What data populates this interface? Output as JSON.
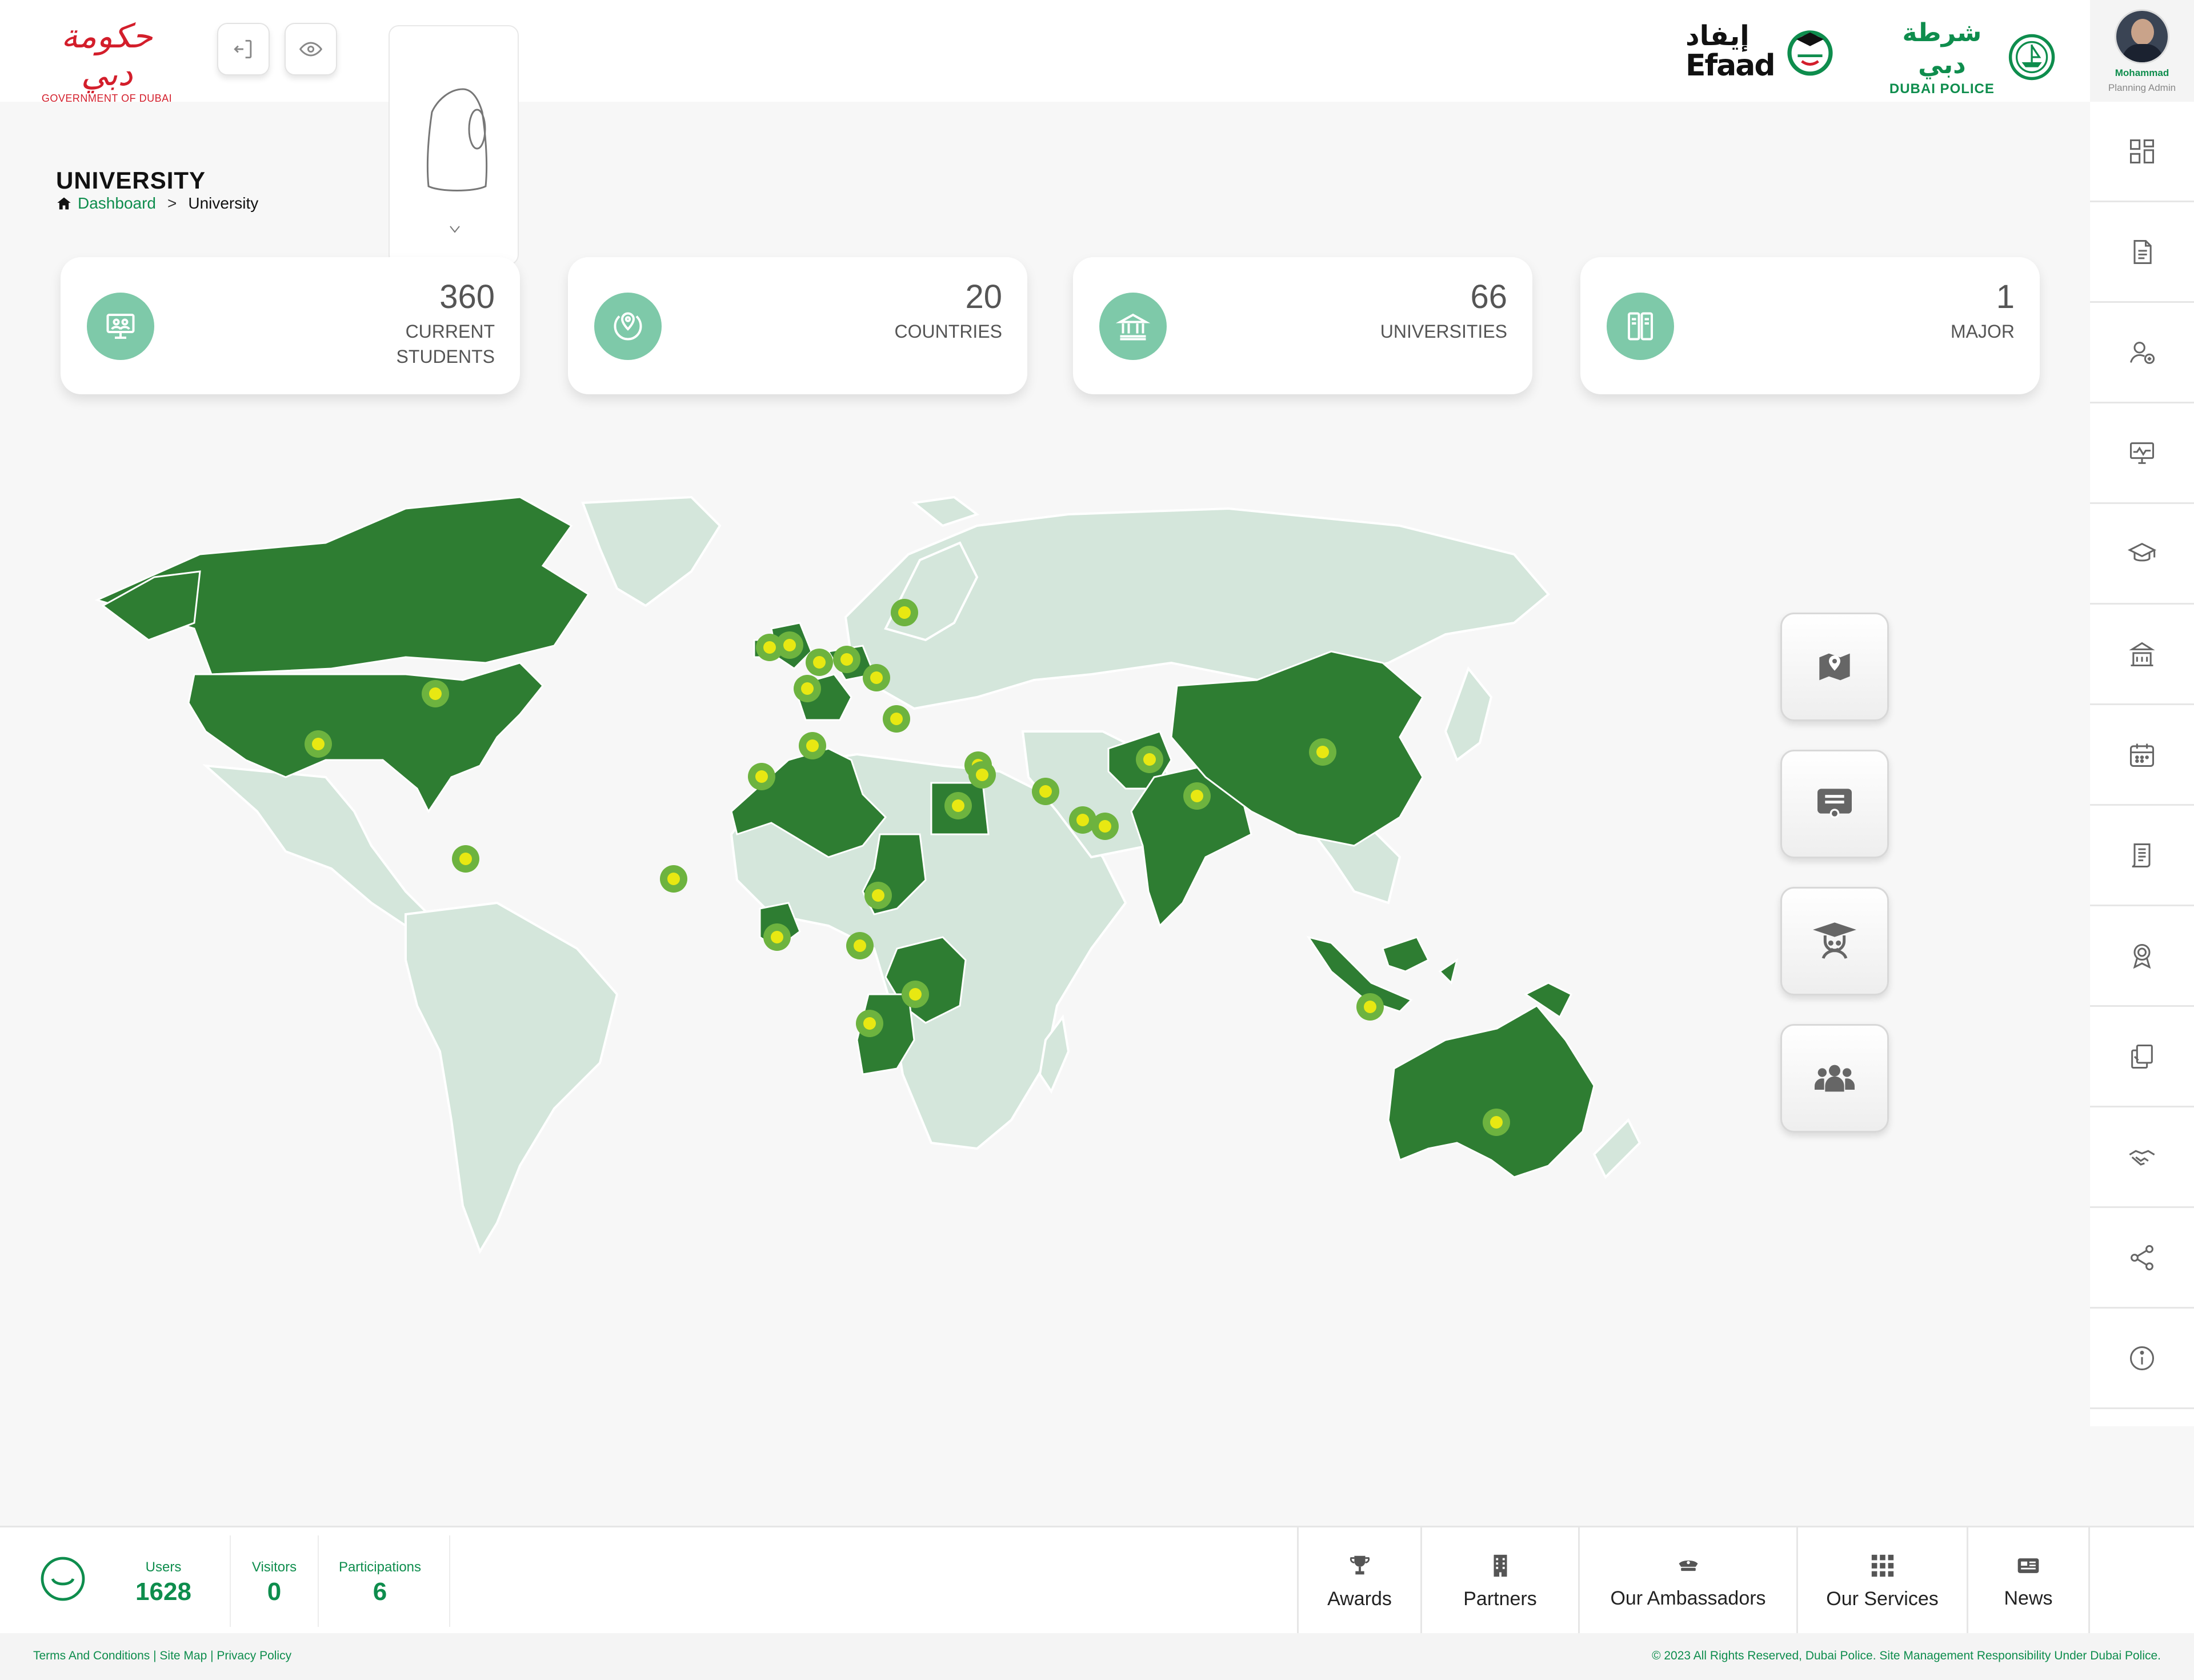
{
  "header": {
    "gov_logo_ar": "حكومة دبي",
    "gov_logo_en": "GOVERNMENT OF DUBAI",
    "efaad_ar": "إيفاد",
    "efaad_en": "Efaad",
    "police_ar": "شرطة دبي",
    "police_en": "DUBAI POLICE",
    "user_name": "Mohammad",
    "user_role": "Planning Admin",
    "icons": [
      "logout-icon",
      "eye-icon"
    ]
  },
  "page": {
    "title": "UNIVERSITY",
    "breadcrumb": [
      "Dashboard",
      "University"
    ]
  },
  "stats": [
    {
      "value": "360",
      "label_line1": "CURRENT",
      "label_line2": "STUDENTS",
      "icon": "students-board-icon"
    },
    {
      "value": "20",
      "label_line1": "COUNTRIES",
      "label_line2": "",
      "icon": "globe-map-icon"
    },
    {
      "value": "66",
      "label_line1": "UNIVERSITIES",
      "label_line2": "",
      "icon": "university-building-icon"
    },
    {
      "value": "1",
      "label_line1": "MAJOR",
      "label_line2": "",
      "icon": "books-icon"
    }
  ],
  "map": {
    "highlight_color": "#2e7d32",
    "base_color": "#d4e6db",
    "marker_color": "#e8e812",
    "marker_ring": "#6db33f"
  },
  "floating_buttons": [
    "map-pin-icon",
    "certificate-icon",
    "graduate-icon",
    "group-icon"
  ],
  "sidebar_icons": [
    "dashboard-icon",
    "document-icon",
    "user-add-icon",
    "monitor-chart-icon",
    "graduation-cap-icon",
    "university-icon",
    "calendar-icon",
    "report-icon",
    "award-icon",
    "copy-icon",
    "handshake-icon",
    "share-icon",
    "info-icon"
  ],
  "footer": {
    "users_label": "Users",
    "users_value": "1628",
    "visitors_label": "Visitors",
    "visitors_value": "0",
    "participations_label": "Participations",
    "participations_value": "6",
    "nav": [
      "Awards",
      "Partners",
      "Our Ambassadors",
      "Our Services",
      "News"
    ],
    "links": "Terms And Conditions  | Site Map  | Privacy Policy",
    "copyright": "© 2023 All Rights Reserved, Dubai Police. Site Management Responsibility Under Dubai Police."
  }
}
